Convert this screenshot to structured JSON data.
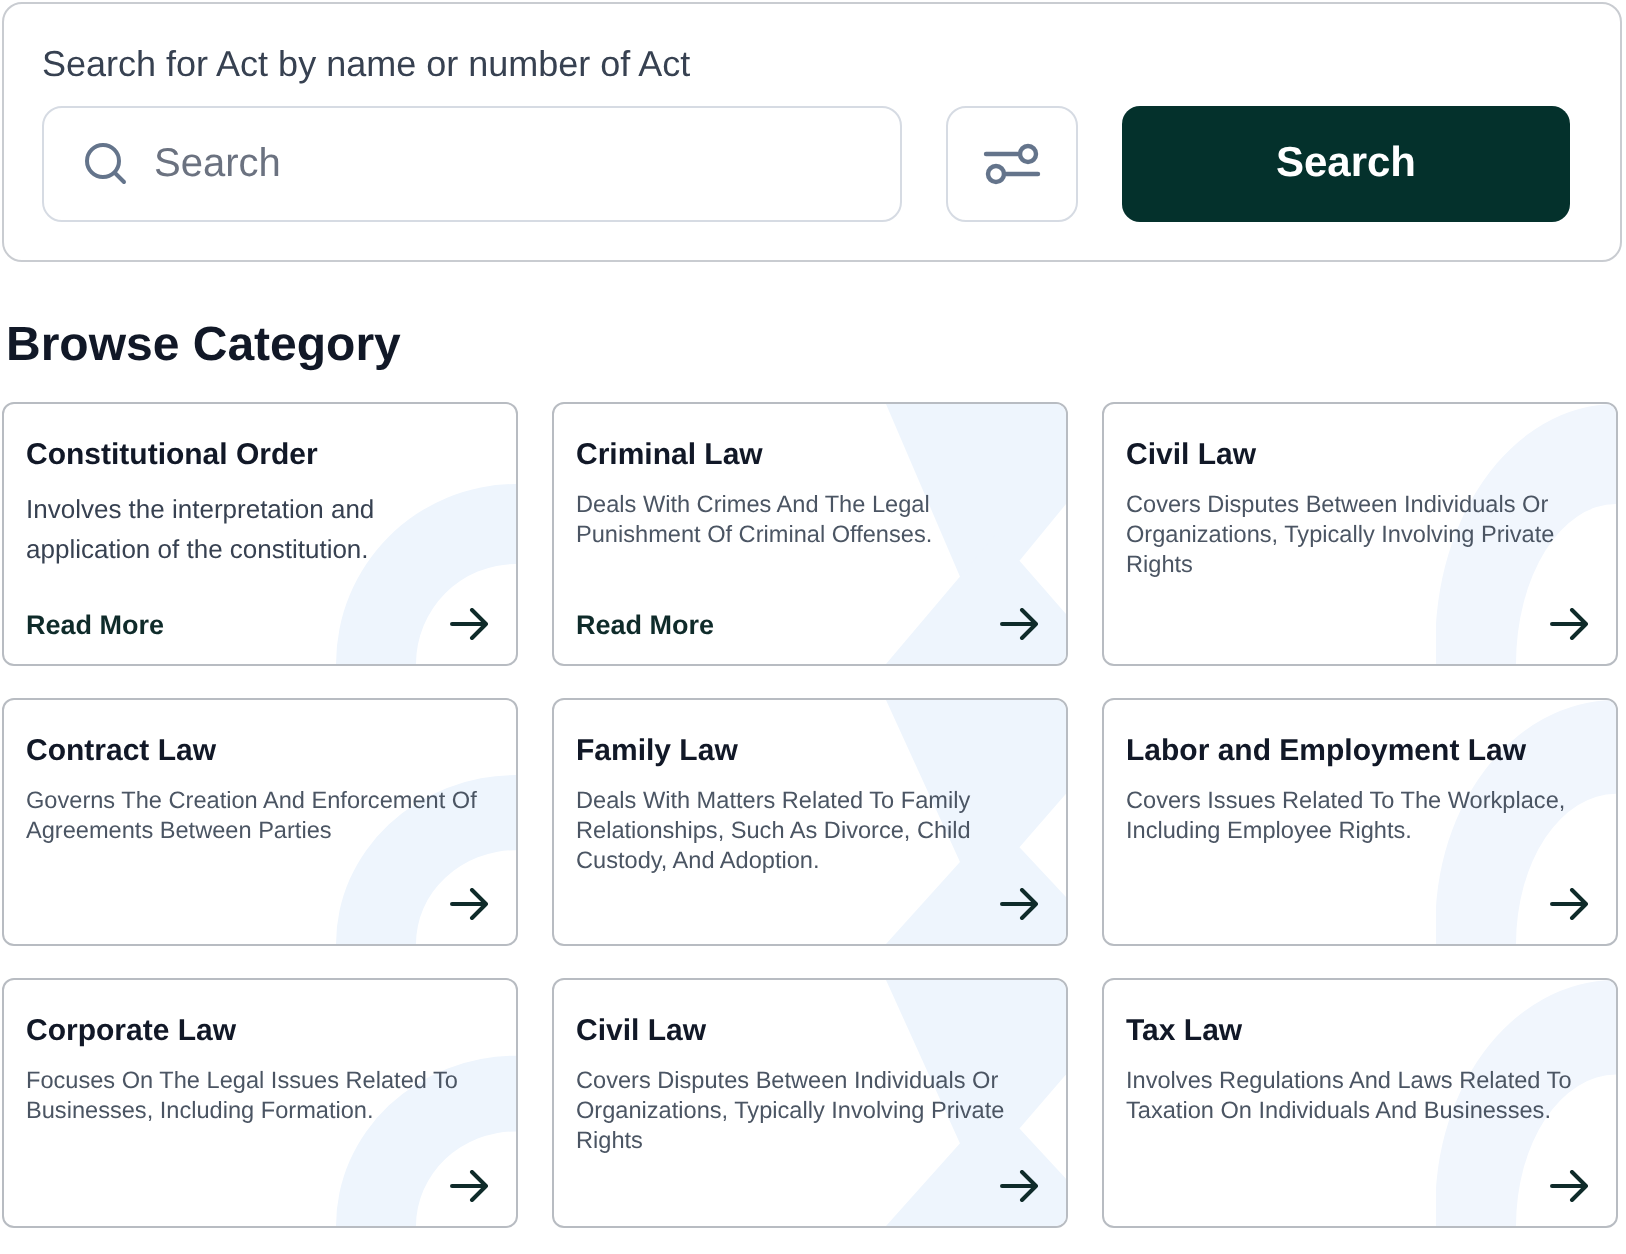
{
  "search_panel": {
    "label": "Search for Act by name or number of Act",
    "field": {
      "placeholder": "Search"
    },
    "button": "Search"
  },
  "heading": "Browse Category",
  "categories": [
    {
      "title": "Constitutional Order",
      "description": "Involves the interpretation and application of the constitution.",
      "link": "Read More"
    },
    {
      "title": "Criminal Law",
      "description": "Deals With Crimes And The Legal Punishment Of Criminal Offenses.",
      "link": "Read More"
    },
    {
      "title": "Civil Law",
      "description": "Covers Disputes Between Individuals Or Organizations, Typically Involving Private Rights"
    },
    {
      "title": "Contract Law",
      "description": "Governs The Creation And Enforcement Of Agreements Between Parties"
    },
    {
      "title": "Family Law",
      "description": "Deals With Matters Related To Family Relationships, Such As Divorce, Child Custody, And Adoption."
    },
    {
      "title": "Labor and Employment Law",
      "description": "Covers Issues Related To The Workplace, Including Employee Rights."
    },
    {
      "title": "Corporate Law",
      "description": "Focuses On The Legal Issues Related To Businesses, Including Formation."
    },
    {
      "title": "Civil Law",
      "description": "Covers Disputes Between Individuals Or Organizations, Typically Involving Private Rights"
    },
    {
      "title": "Tax Law",
      "description": "Involves Regulations And Laws Related To Taxation On Individuals And Businesses."
    }
  ]
}
